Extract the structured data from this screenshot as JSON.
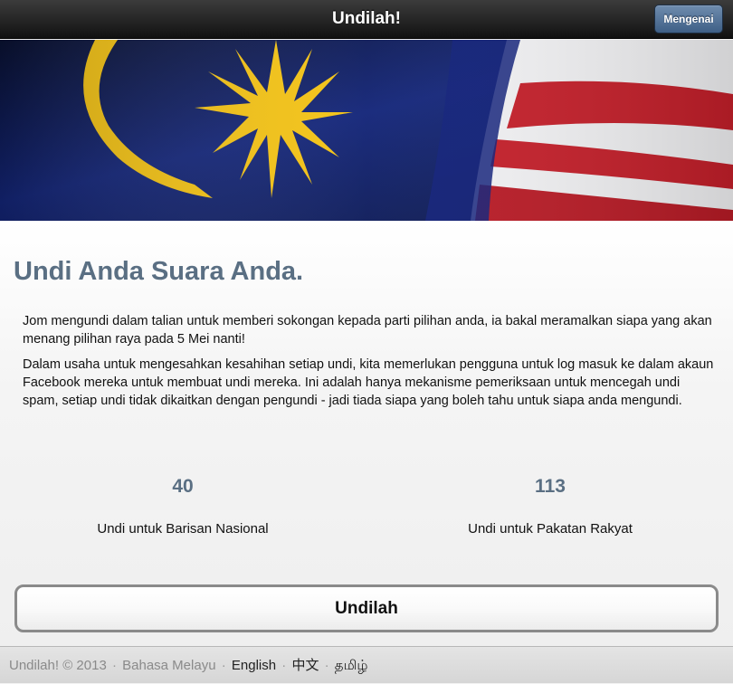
{
  "header": {
    "title": "Undilah!",
    "about_button": "Mengenai"
  },
  "banner": {
    "image": "malaysian-flag",
    "colors": {
      "navy": "#0b1a55",
      "yellow": "#f3c214",
      "red": "#c8202b",
      "white": "#f4f4f4"
    }
  },
  "main": {
    "headline": "Undi Anda Suara Anda.",
    "paragraphs": [
      "Jom mengundi dalam talian untuk memberi sokongan kepada parti pilihan anda, ia bakal meramalkan siapa yang akan menang pilihan raya pada 5 Mei nanti!",
      "Dalam usaha untuk mengesahkan kesahihan setiap undi, kita memerlukan pengguna untuk log masuk ke dalam akaun Facebook mereka untuk membuat undi mereka. Ini adalah hanya mekanisme pemeriksaan untuk mencegah undi spam, setiap undi tidak dikaitkan dengan pengundi - jadi tiada siapa yang boleh tahu untuk siapa anda mengundi."
    ],
    "stats": [
      {
        "count": "40",
        "label": "Undi untuk Barisan Nasional"
      },
      {
        "count": "113",
        "label": "Undi untuk Pakatan Rakyat"
      }
    ],
    "vote_button": "Undilah"
  },
  "footer": {
    "copyright": "Undilah! © 2013",
    "separator": "·",
    "languages": [
      "Bahasa Melayu",
      "English",
      "中文",
      "தமிழ்"
    ]
  }
}
